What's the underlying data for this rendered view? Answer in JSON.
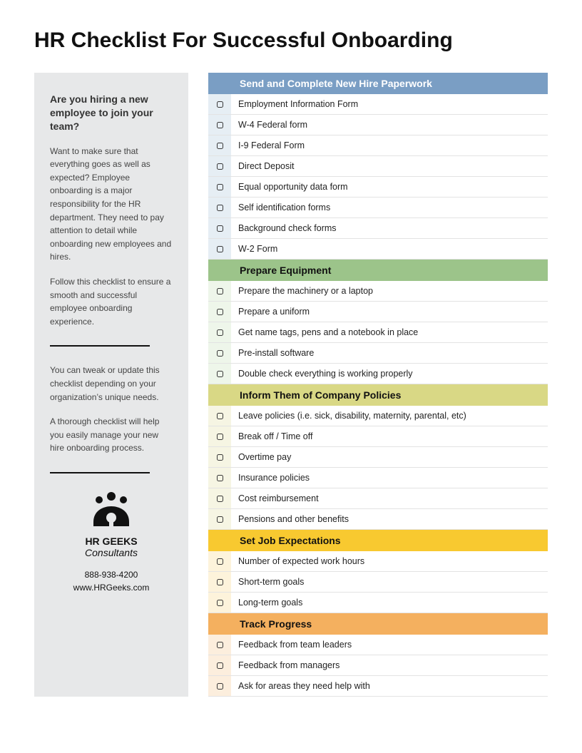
{
  "title": "HR Checklist For Successful Onboarding",
  "sidebar": {
    "heading": "Are you hiring a new employee to join your team?",
    "para1": "Want to make sure that everything goes as well as expected? Employee onboarding is a major responsibility for the HR department. They need to pay attention to detail while onboarding new employees and hires.",
    "para2": "Follow this checklist to ensure a smooth and successful employee onboarding experience.",
    "para3": "You can tweak or update this checklist depending on your organization’s unique needs.",
    "para4": "A thorough checklist will help you easily manage your new hire onboarding process.",
    "logo_name": "HR GEEKS",
    "logo_sub": "Consultants",
    "phone": "888-938-4200",
    "website": "www.HRGeeks.com"
  },
  "sections": [
    {
      "title": "Send and Complete New Hire Paperwork",
      "header_class": "header-blue",
      "tint_class": "tint-blue",
      "items": [
        "Employment Information Form",
        "W-4 Federal form",
        "I-9 Federal Form",
        "Direct Deposit",
        "Equal opportunity data form",
        "Self identification forms",
        "Background check forms",
        "W-2 Form"
      ]
    },
    {
      "title": "Prepare Equipment",
      "header_class": "header-green",
      "tint_class": "tint-green",
      "items": [
        "Prepare the machinery or a laptop",
        "Prepare a uniform",
        "Get name tags, pens and a notebook in place",
        "Pre-install software",
        "Double check everything is working properly"
      ]
    },
    {
      "title": "Inform Them of Company Policies",
      "header_class": "header-olive",
      "tint_class": "tint-olive",
      "items": [
        "Leave policies (i.e. sick, disability, maternity, parental, etc)",
        "Break off / Time off",
        "Overtime pay",
        "Insurance policies",
        "Cost reimbursement",
        "Pensions and other benefits"
      ]
    },
    {
      "title": "Set Job Expectations",
      "header_class": "header-yellow",
      "tint_class": "tint-yellow",
      "items": [
        "Number of expected work hours",
        "Short-term goals",
        "Long-term goals"
      ]
    },
    {
      "title": "Track Progress",
      "header_class": "header-orange",
      "tint_class": "tint-orange",
      "items": [
        "Feedback from team leaders",
        "Feedback from managers",
        "Ask for areas they need help with"
      ]
    }
  ]
}
